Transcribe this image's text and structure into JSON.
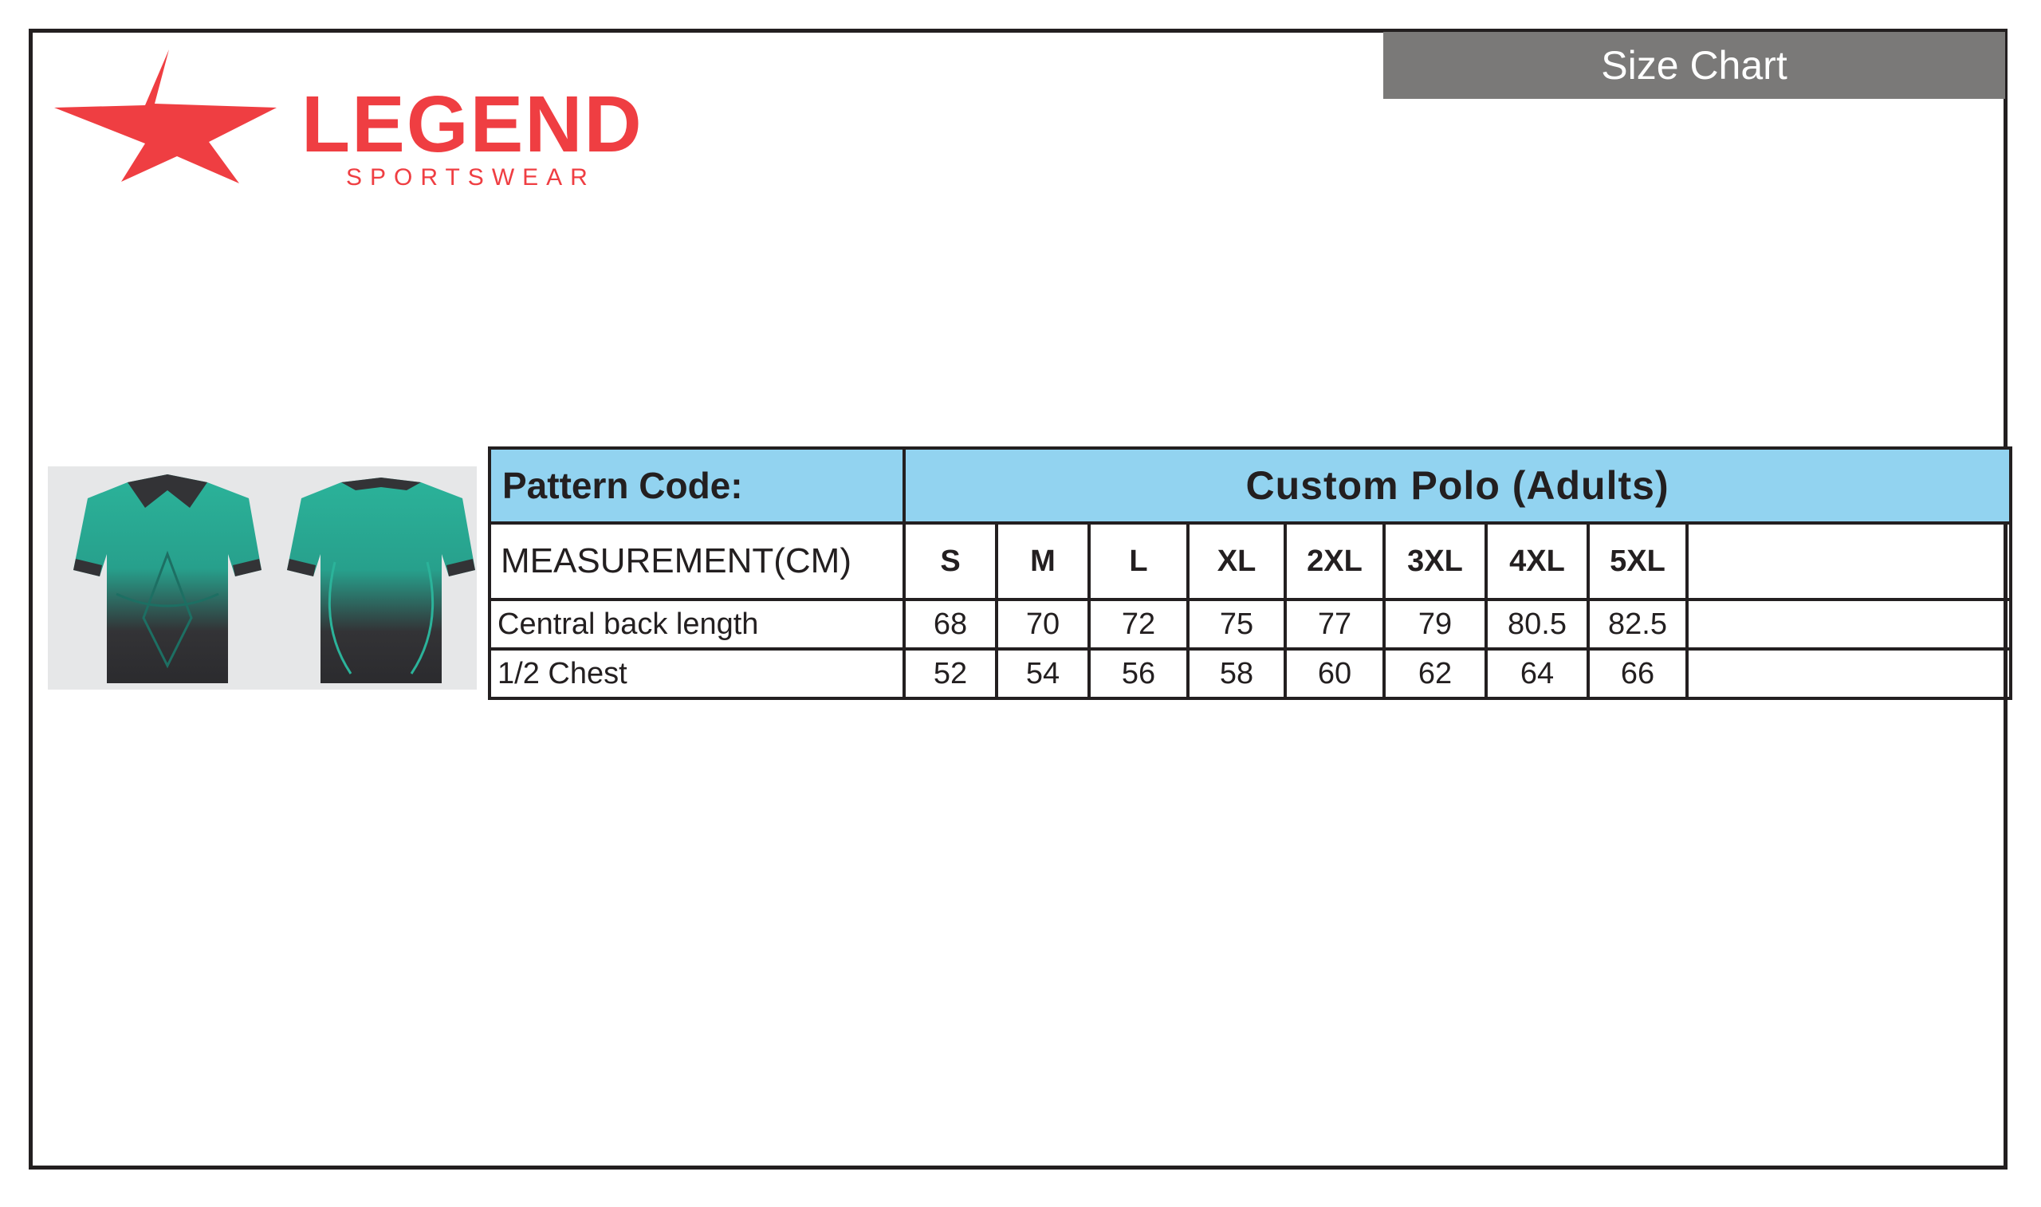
{
  "header": {
    "tab_label": "Size Chart"
  },
  "brand": {
    "name": "LEGEND",
    "tagline": "SPORTSWEAR",
    "color": "#ef3e42"
  },
  "product_image": {
    "front": "polo-front",
    "back": "polo-back",
    "primary_color": "#2bb39a",
    "secondary_color": "#333336"
  },
  "size_table": {
    "pattern_label": "Pattern Code:",
    "product_title": "Custom Polo (Adults)",
    "measurement_label": "MEASUREMENT(CM)",
    "sizes": [
      "S",
      "M",
      "L",
      "XL",
      "2XL",
      "3XL",
      "4XL",
      "5XL"
    ],
    "rows": [
      {
        "label": "Central back length",
        "values": [
          "68",
          "70",
          "72",
          "75",
          "77",
          "79",
          "80.5",
          "82.5"
        ]
      },
      {
        "label": "1/2 Chest",
        "values": [
          "52",
          "54",
          "56",
          "58",
          "60",
          "62",
          "64",
          "66"
        ]
      }
    ],
    "header_color": "#92d3f0"
  }
}
